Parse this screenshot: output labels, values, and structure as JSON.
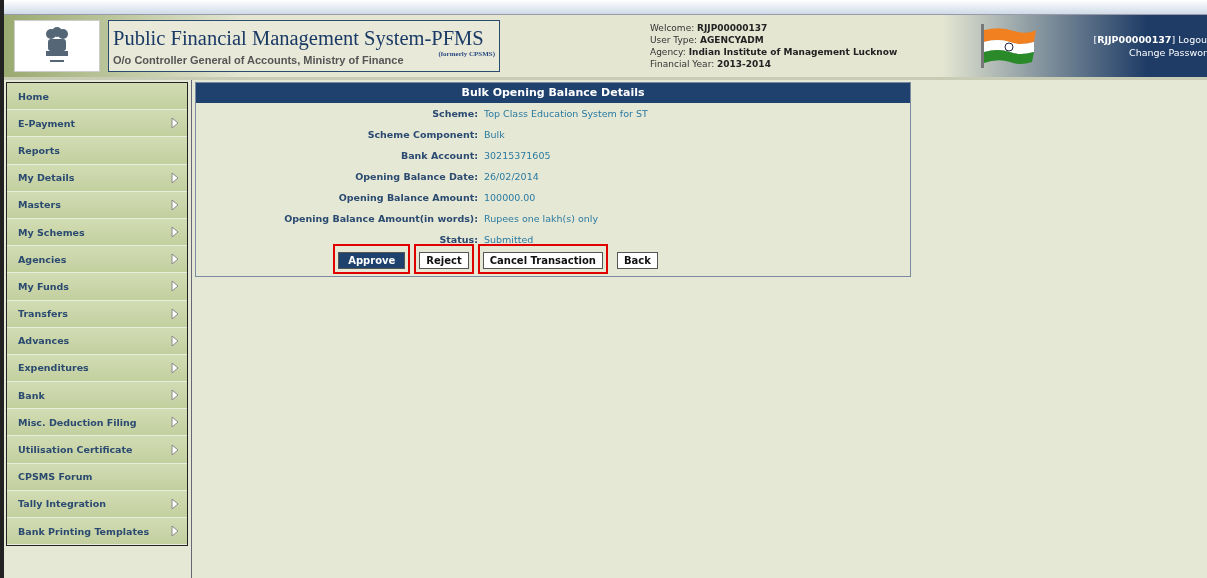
{
  "header": {
    "title": "Public Financial Management System-PFMS",
    "formerly": "(formerly CPSMS)",
    "subtitle": "O/o Controller General of Accounts, Ministry of Finance",
    "user_info": [
      {
        "label": "Welcome:",
        "value": "RJJP00000137"
      },
      {
        "label": "User Type:",
        "value": "AGENCYADM"
      },
      {
        "label": "Agency:",
        "value": "Indian Institute of Management Lucknow"
      },
      {
        "label": "Financial Year:",
        "value": "2013-2014"
      }
    ],
    "account_link": "[**RJJP00000137**] Logou",
    "change_password": "Change Passwor"
  },
  "sidebar": {
    "items": [
      {
        "label": "Home",
        "has_submenu": false
      },
      {
        "label": "E-Payment",
        "has_submenu": true
      },
      {
        "label": "Reports",
        "has_submenu": false
      },
      {
        "label": "My Details",
        "has_submenu": true
      },
      {
        "label": "Masters",
        "has_submenu": true
      },
      {
        "label": "My Schemes",
        "has_submenu": true
      },
      {
        "label": "Agencies",
        "has_submenu": true
      },
      {
        "label": "My Funds",
        "has_submenu": true
      },
      {
        "label": "Transfers",
        "has_submenu": true
      },
      {
        "label": "Advances",
        "has_submenu": true
      },
      {
        "label": "Expenditures",
        "has_submenu": true
      },
      {
        "label": "Bank",
        "has_submenu": true
      },
      {
        "label": "Misc. Deduction Filing",
        "has_submenu": true
      },
      {
        "label": "Utilisation Certificate",
        "has_submenu": true
      },
      {
        "label": "CPSMS Forum",
        "has_submenu": false
      },
      {
        "label": "Tally Integration",
        "has_submenu": true
      },
      {
        "label": "Bank Printing Templates",
        "has_submenu": true
      }
    ]
  },
  "panel": {
    "title": "Bulk Opening Balance Details",
    "fields": [
      {
        "label": "Scheme:",
        "value": "Top Class Education System for ST"
      },
      {
        "label": "Scheme Component:",
        "value": "Bulk"
      },
      {
        "label": "Bank Account:",
        "value": "30215371605"
      },
      {
        "label": "Opening Balance Date:",
        "value": "26/02/2014"
      },
      {
        "label": "Opening Balance Amount:",
        "value": "100000.00"
      },
      {
        "label": "Opening Balance Amount(in words):",
        "value": "Rupees one lakh(s) only"
      },
      {
        "label": "Status:",
        "value": "Submitted"
      }
    ],
    "buttons": [
      {
        "label": "Approve",
        "focused": true,
        "highlighted": true
      },
      {
        "label": "Reject",
        "focused": false,
        "highlighted": true
      },
      {
        "label": "Cancel Transaction",
        "focused": false,
        "highlighted": true
      },
      {
        "label": "Back",
        "focused": false,
        "highlighted": false
      }
    ]
  }
}
